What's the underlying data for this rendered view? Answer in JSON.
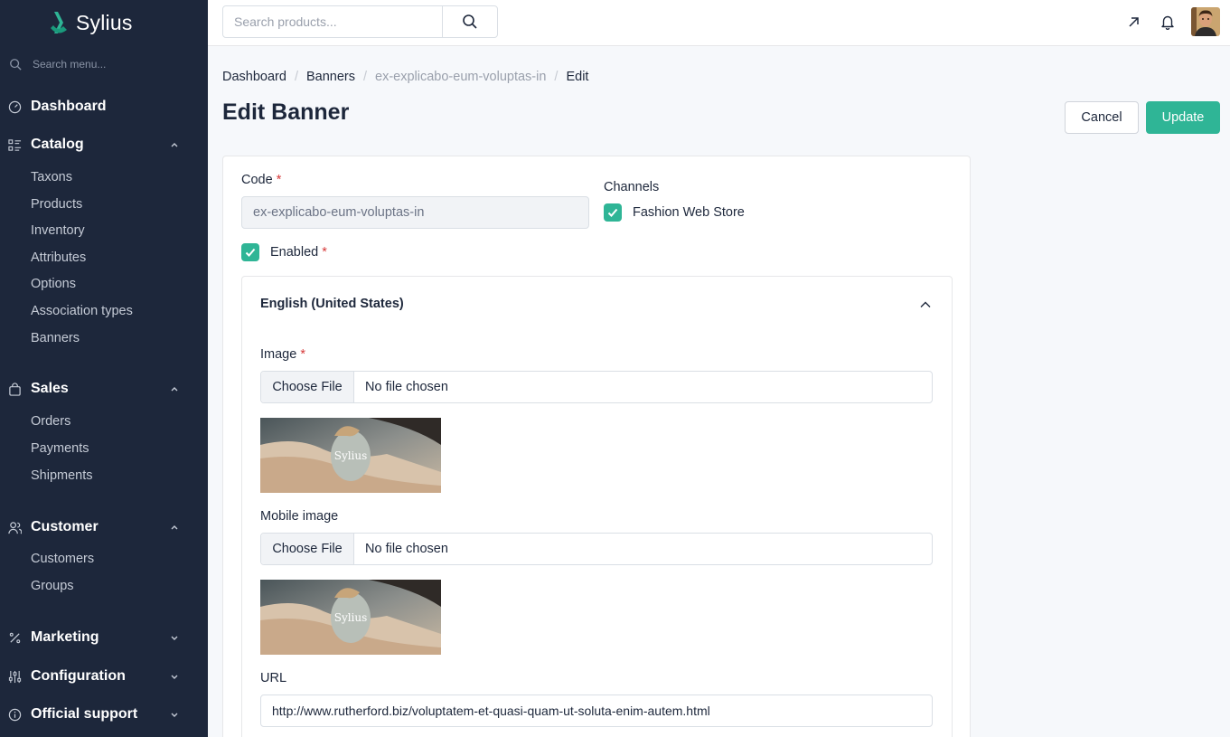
{
  "brand": {
    "name": "Sylius",
    "accent": "#2fb596",
    "sidebar_bg": "#1d273b"
  },
  "sidebar": {
    "search_placeholder": "Search menu...",
    "dashboard": "Dashboard",
    "catalog": {
      "label": "Catalog",
      "items": [
        "Taxons",
        "Products",
        "Inventory",
        "Attributes",
        "Options",
        "Association types",
        "Banners"
      ]
    },
    "sales": {
      "label": "Sales",
      "items": [
        "Orders",
        "Payments",
        "Shipments"
      ]
    },
    "customer": {
      "label": "Customer",
      "items": [
        "Customers",
        "Groups"
      ]
    },
    "marketing": "Marketing",
    "configuration": "Configuration",
    "official_support": "Official support"
  },
  "topbar": {
    "search_placeholder": "Search products..."
  },
  "breadcrumb": {
    "dashboard": "Dashboard",
    "banners": "Banners",
    "current_code": "ex-explicabo-eum-voluptas-in",
    "edit": "Edit"
  },
  "page": {
    "title": "Edit Banner",
    "cancel": "Cancel",
    "update": "Update"
  },
  "form": {
    "code_label": "Code",
    "required_mark": "*",
    "code_value": "ex-explicabo-eum-voluptas-in",
    "channels_label": "Channels",
    "channel_name": "Fashion Web Store",
    "enabled_label": "Enabled",
    "locale_title": "English (United States)",
    "image_label": "Image",
    "mobile_image_label": "Mobile image",
    "choose_file": "Choose File",
    "no_file": "No file chosen",
    "url_label": "URL",
    "url_value": "http://www.rutherford.biz/voluptatem-et-quasi-quam-ut-soluta-enim-autem.html"
  },
  "preview_watermark": "Sylius"
}
